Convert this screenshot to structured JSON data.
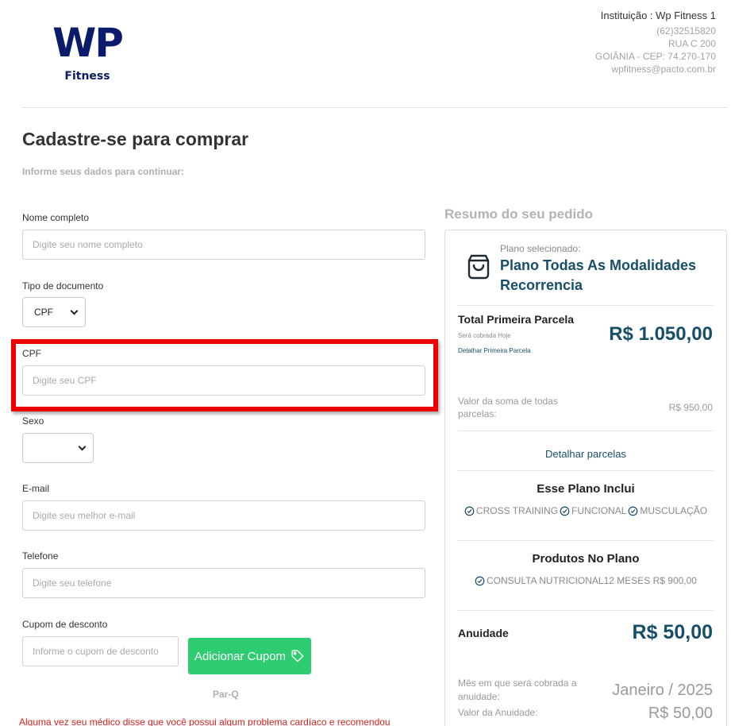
{
  "header": {
    "logo_main": "WP",
    "logo_sub": "Fitness",
    "institution": "Instituição : Wp Fitness 1",
    "phone": "(62)32515820",
    "address": "RUA C 200",
    "city": "GOIÂNIA - CEP: 74.270-170",
    "email": "wpfitness@pacto.com.br"
  },
  "form": {
    "title": "Cadastre-se para comprar",
    "subtitle": "Informe seus dados para continuar:",
    "name_label": "Nome completo",
    "name_placeholder": "Digite seu nome completo",
    "doc_type_label": "Tipo de documento",
    "doc_type_value": "CPF",
    "cpf_label": "CPF",
    "cpf_placeholder": "Digite seu CPF",
    "sex_label": "Sexo",
    "sex_value": "",
    "email_label": "E-mail",
    "email_placeholder": "Digite seu melhor e-mail",
    "phone_label": "Telefone",
    "phone_placeholder": "Digite seu telefone",
    "coupon_label": "Cupom de desconto",
    "coupon_placeholder": "Informe o cupom de desconto",
    "coupon_button": "Adicionar Cupom",
    "parq": "Par-Q",
    "warning": "Alguma vez seu médico disse que você possui algum problema cardíaco e recomendou"
  },
  "summary": {
    "heading": "Resumo do seu pedido",
    "plan_small": "Plano selecionado:",
    "plan_name": "Plano Todas As Modalidades Recorrencia",
    "total_title": "Total Primeira Parcela",
    "total_sub": "Será cobrada Hoje",
    "total_link": "Detalhar Primeira Parcela",
    "total_price": "R$ 1.050,00",
    "sum_label": "Valor da soma de todas parcelas:",
    "sum_value": "R$ 950,00",
    "detail_link": "Detalhar parcelas",
    "includes_title": "Esse Plano Inclui",
    "includes": [
      "CROSS TRAINING",
      "FUNCIONAL",
      "MUSCULAÇÃO"
    ],
    "products_title": "Produtos No Plano",
    "products": [
      "CONSULTA NUTRICIONAL12 MESES R$ 900,00"
    ],
    "annuity_label": "Anuidade",
    "annuity_value": "R$ 50,00",
    "month_label": "Mês em que será cobrada a anuidade:",
    "month_value": "Janeiro / 2025",
    "annuity_value_label": "Valor da Anuidade:",
    "annuity_value_amount": "R$ 50,00"
  },
  "colors": {
    "brand": "#0b1b6b",
    "accent": "#174e6a",
    "button": "#2ecc71",
    "highlight": "#ee0000",
    "warning": "#d9211c"
  }
}
